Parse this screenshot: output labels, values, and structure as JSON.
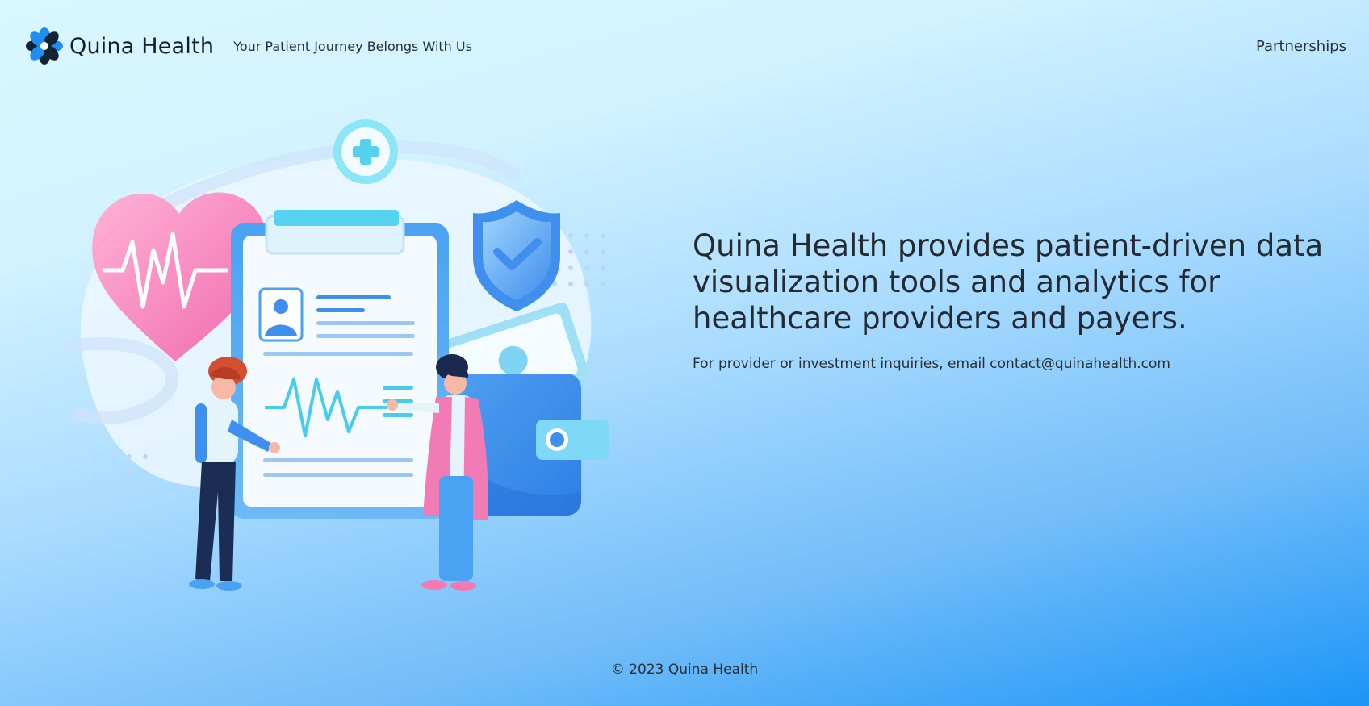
{
  "header": {
    "logo_icon": "quina-flower-logo-icon",
    "brand": "Quina Health",
    "tagline": "Your Patient Journey Belongs With Us",
    "nav": {
      "partnerships": "Partnerships"
    }
  },
  "hero": {
    "illustration": "medical-clipboard-illustration",
    "headline": "Quina Health provides patient-driven data visualization tools and analytics for healthcare providers and payers.",
    "contact": "For provider or investment inquiries, email contact@quinahealth.com"
  },
  "footer": {
    "copyright": "© 2023 Quina Health"
  },
  "colors": {
    "brand_blue": "#1e8ef0",
    "brand_dark": "#142433",
    "heart_pink": "#f27bb6",
    "background_top": "#d9f7ff",
    "background_bottom": "#0a8bf5"
  }
}
